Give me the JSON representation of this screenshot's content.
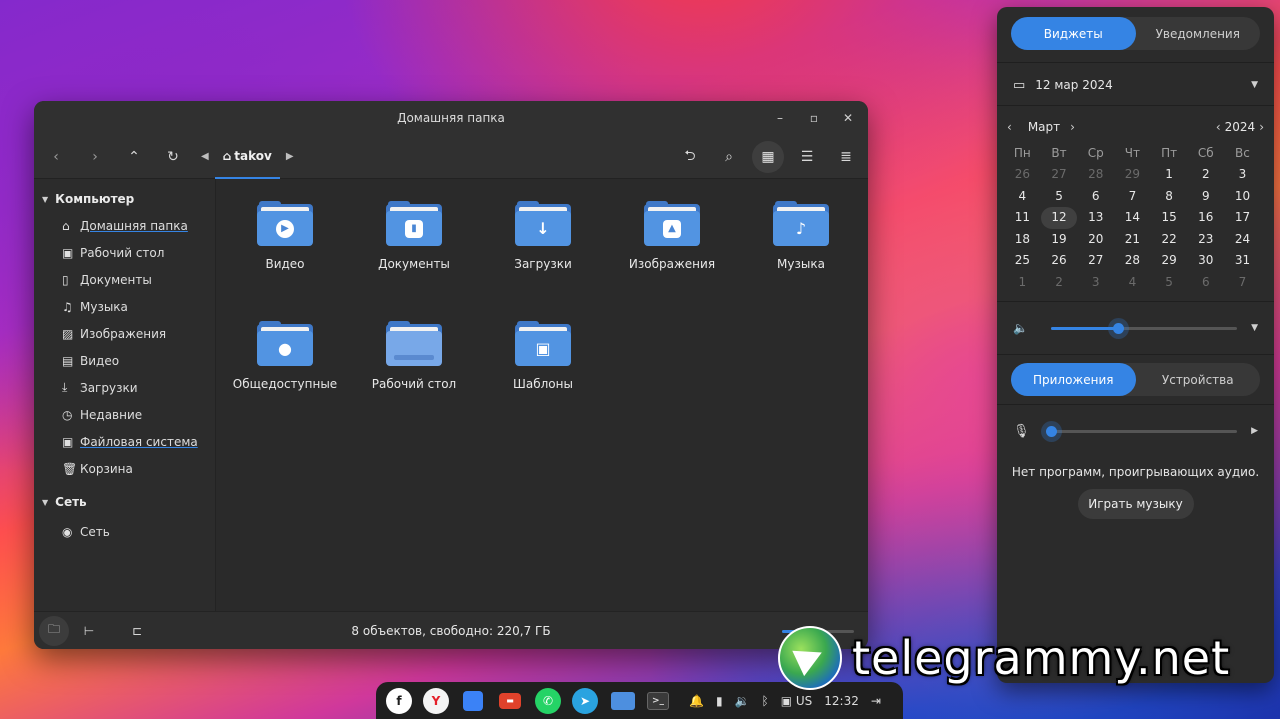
{
  "window": {
    "title": "Домашняя папка",
    "breadcrumb": "takov"
  },
  "sidebar": {
    "computer_label": "Компьютер",
    "items": [
      {
        "label": "Домашняя папка",
        "icon": "home-icon"
      },
      {
        "label": "Рабочий стол",
        "icon": "desktop-icon"
      },
      {
        "label": "Документы",
        "icon": "document-icon"
      },
      {
        "label": "Музыка",
        "icon": "music-icon"
      },
      {
        "label": "Изображения",
        "icon": "image-icon"
      },
      {
        "label": "Видео",
        "icon": "video-icon"
      },
      {
        "label": "Загрузки",
        "icon": "download-icon"
      },
      {
        "label": "Недавние",
        "icon": "clock-icon"
      },
      {
        "label": "Файловая система",
        "icon": "drive-icon"
      },
      {
        "label": "Корзина",
        "icon": "trash-icon"
      }
    ],
    "network_label": "Сеть",
    "network_items": [
      {
        "label": "Сеть",
        "icon": "network-icon"
      }
    ]
  },
  "files": [
    {
      "name": "Видео",
      "emblem": "▶"
    },
    {
      "name": "Документы",
      "emblem": "▮"
    },
    {
      "name": "Загрузки",
      "emblem": "↓"
    },
    {
      "name": "Изображения",
      "emblem": "▲"
    },
    {
      "name": "Музыка",
      "emblem": "♪"
    },
    {
      "name": "Общедоступные",
      "emblem": "●"
    },
    {
      "name": "Рабочий стол",
      "emblem": ""
    },
    {
      "name": "Шаблоны",
      "emblem": "▣"
    }
  ],
  "status": {
    "text": "8 объектов, свободно: 220,7 ГБ",
    "zoom_fraction": 0.5
  },
  "panel": {
    "tabs": [
      "Виджеты",
      "Уведомления"
    ],
    "date_value": "12 мар 2024",
    "calendar": {
      "month": "Март",
      "year": "2024",
      "weekdays": [
        "Пн",
        "Вт",
        "Ср",
        "Чт",
        "Пт",
        "Сб",
        "Вс"
      ],
      "days": [
        [
          "26",
          "27",
          "28",
          "29",
          "1",
          "2",
          "3"
        ],
        [
          "4",
          "5",
          "6",
          "7",
          "8",
          "9",
          "10"
        ],
        [
          "11",
          "12",
          "13",
          "14",
          "15",
          "16",
          "17"
        ],
        [
          "18",
          "19",
          "20",
          "21",
          "22",
          "23",
          "24"
        ],
        [
          "25",
          "26",
          "27",
          "28",
          "29",
          "30",
          "31"
        ],
        [
          "1",
          "2",
          "3",
          "4",
          "5",
          "6",
          "7"
        ]
      ],
      "today": "12"
    },
    "volume_fraction": 0.36,
    "audio_tabs": [
      "Приложения",
      "Устройства"
    ],
    "mic_fraction": 0.0,
    "no_audio_text": "Нет программ, проигрывающих аудио.",
    "play_music_label": "Играть музыку"
  },
  "taskbar": {
    "keyboard_layout": "US",
    "time": "12:32"
  },
  "watermark": {
    "text": "telegrammy.net"
  },
  "colors": {
    "accent": "#3584e4",
    "window_bg": "#2a2a2a",
    "folder_blue": "#5294e2"
  }
}
